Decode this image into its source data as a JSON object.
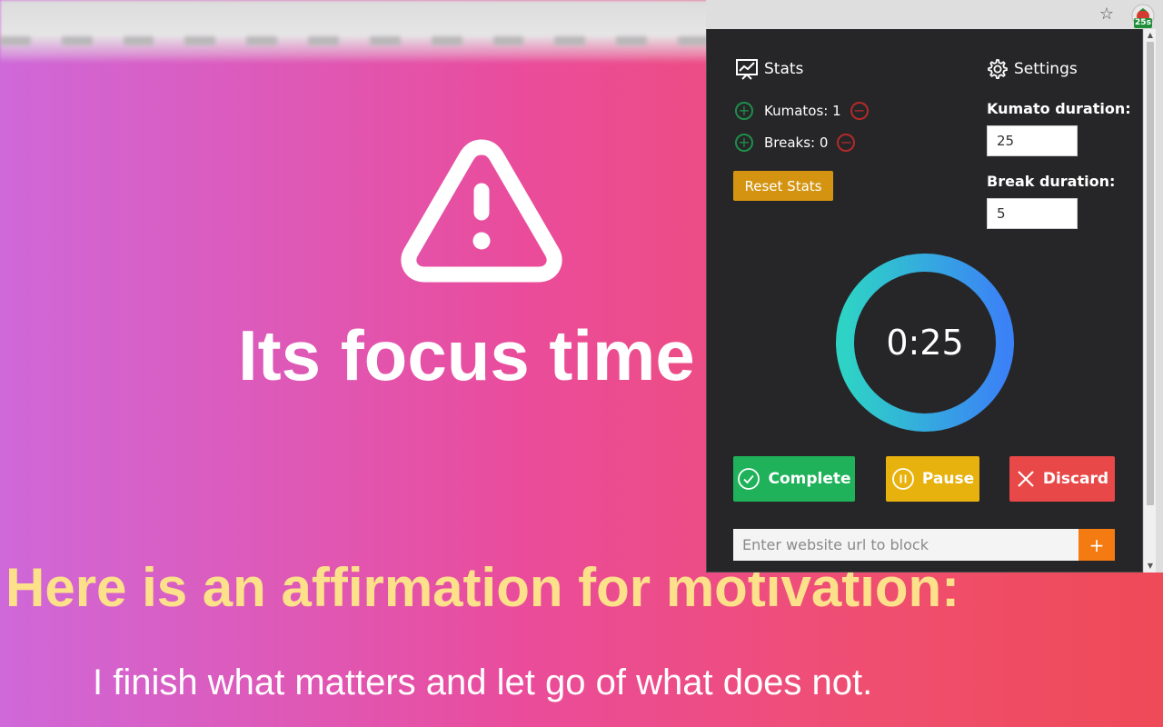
{
  "page": {
    "focus_title": "Its focus time",
    "affirmation_heading": "Here is an affirmation for motivation:",
    "affirmation_text": "I finish what matters and let go of what does not."
  },
  "browser": {
    "extension_badge": "25s"
  },
  "popup": {
    "stats": {
      "heading": "Stats",
      "kumatos_label": "Kumatos: 1",
      "breaks_label": "Breaks: 0",
      "reset_label": "Reset Stats"
    },
    "settings": {
      "heading": "Settings",
      "kumato_duration_label": "Kumato duration:",
      "kumato_duration_value": "25",
      "break_duration_label": "Break duration:",
      "break_duration_value": "5"
    },
    "timer": {
      "display": "0:25",
      "ring_gradient": [
        "#2ed3c6",
        "#3b82f6"
      ]
    },
    "actions": {
      "complete_label": "Complete",
      "pause_label": "Pause",
      "discard_label": "Discard"
    },
    "block": {
      "placeholder": "Enter website url to block",
      "add_label": "+"
    }
  },
  "colors": {
    "popup_bg": "#262628",
    "reset": "#d49411",
    "complete": "#1fb25a",
    "pause": "#e8b20e",
    "discard": "#e84848",
    "add": "#f47b12",
    "affirmation_heading": "#fde18a"
  }
}
